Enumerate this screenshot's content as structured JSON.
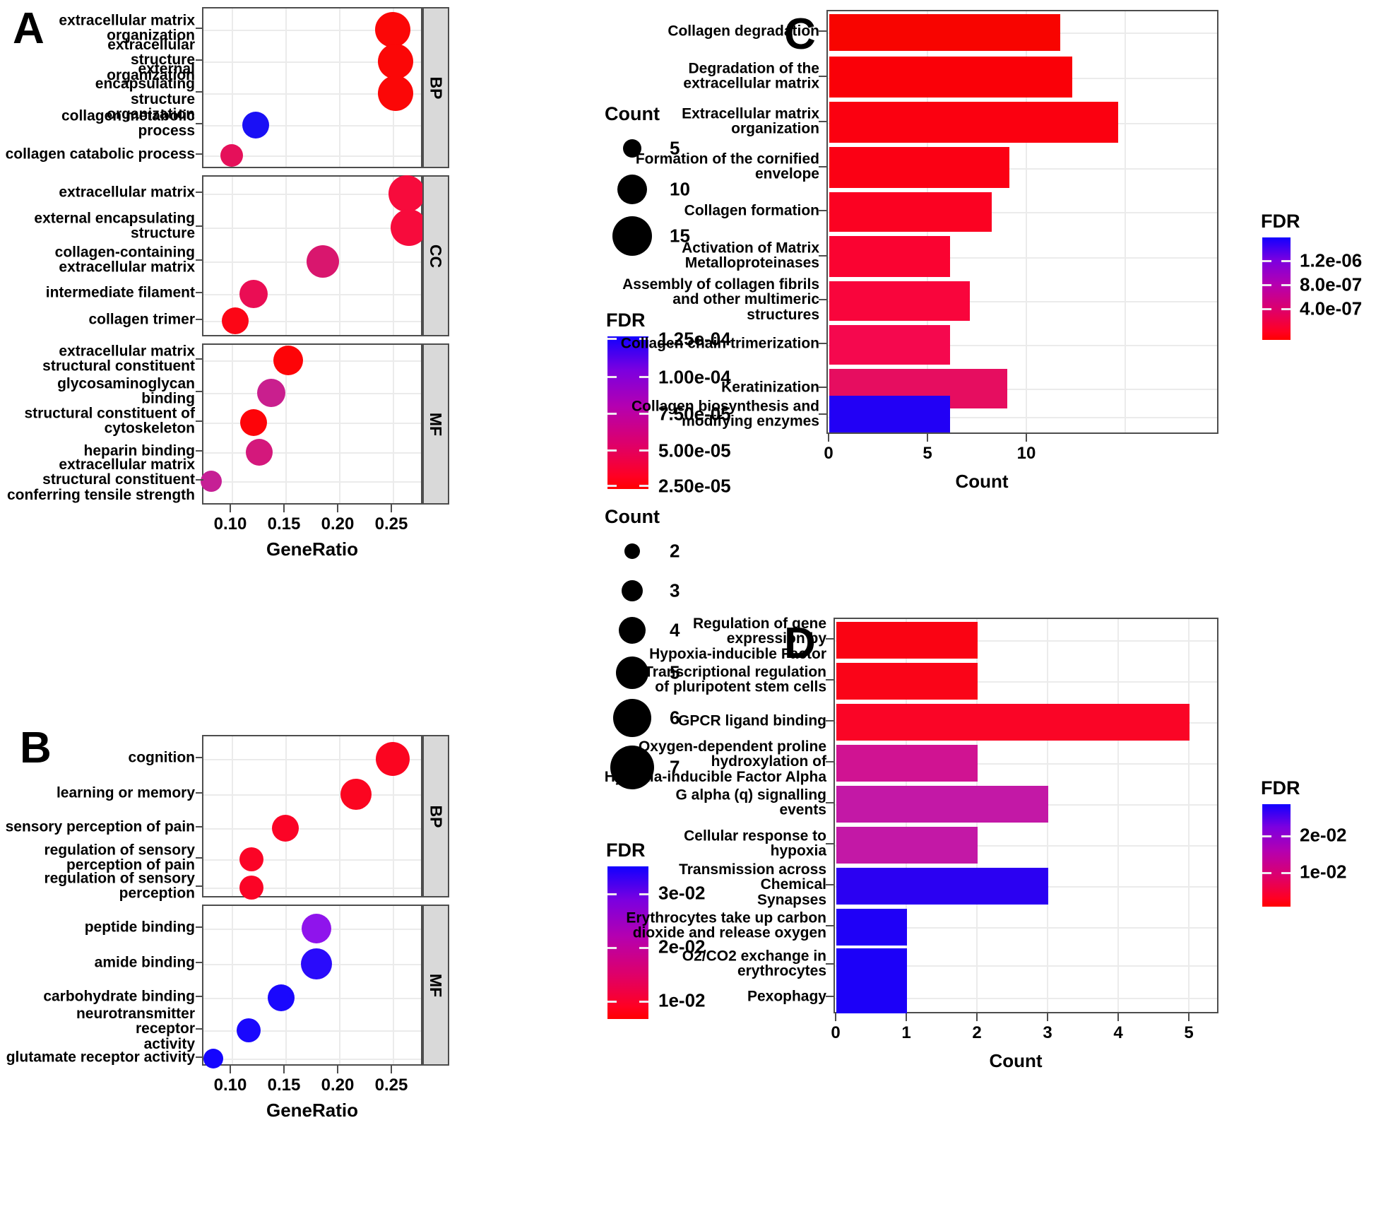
{
  "figure": {
    "panels": [
      "A",
      "B",
      "C",
      "D"
    ]
  },
  "panelA": {
    "letter": "A",
    "xlabel": "GeneRatio",
    "xticks": [
      "0.10",
      "0.15",
      "0.20",
      "0.25"
    ],
    "facets": [
      "BP",
      "CC",
      "MF"
    ],
    "legend": {
      "count_title": "Count",
      "count_values": [
        "5",
        "10",
        "15"
      ],
      "fdr_title": "FDR",
      "fdr_labels": [
        "1.25e-04",
        "1.00e-04",
        "7.50e-05",
        "5.00e-05",
        "2.50e-05"
      ]
    },
    "chart_data": {
      "type": "scatter",
      "title": "",
      "xlabel": "GeneRatio",
      "ylabel": "",
      "xlim": [
        0.06,
        0.265
      ],
      "xticks": [
        0.1,
        0.15,
        0.2,
        0.25
      ],
      "grid": true,
      "size_legend": {
        "name": "Count",
        "values": [
          5,
          10,
          15
        ]
      },
      "color_legend": {
        "name": "FDR",
        "ticks": [
          0.000125,
          0.0001,
          7.5e-05,
          5e-05,
          2.5e-05
        ]
      },
      "facets": [
        {
          "name": "BP",
          "points": [
            {
              "term": "extracellular matrix\norganization",
              "GeneRatio": 0.237,
              "Count": 17,
              "FDR": 2e-05,
              "color": "#fb0707"
            },
            {
              "term": "extracellular structure\norganization",
              "GeneRatio": 0.24,
              "Count": 17,
              "FDR": 2e-05,
              "color": "#fb0707"
            },
            {
              "term": "external encapsulating\nstructure organization",
              "GeneRatio": 0.24,
              "Count": 17,
              "FDR": 2e-05,
              "color": "#fb0707"
            },
            {
              "term": "collagen metabolic process",
              "GeneRatio": 0.112,
              "Count": 8,
              "FDR": 0.000125,
              "color": "#1a10f5"
            },
            {
              "term": "collagen catabolic process",
              "GeneRatio": 0.09,
              "Count": 6,
              "FDR": 3.2e-05,
              "color": "#e5105a"
            }
          ]
        },
        {
          "name": "CC",
          "points": [
            {
              "term": "extracellular matrix",
              "GeneRatio": 0.25,
              "Count": 18,
              "FDR": 2.2e-05,
              "color": "#f70b3c"
            },
            {
              "term": "external encapsulating\nstructure",
              "GeneRatio": 0.252,
              "Count": 18,
              "FDR": 2.2e-05,
              "color": "#f70b3c"
            },
            {
              "term": "collagen-containing\nextracellular matrix",
              "GeneRatio": 0.162,
              "Count": 12,
              "FDR": 4.2e-05,
              "color": "#d9166e"
            },
            {
              "term": "intermediate filament",
              "GeneRatio": 0.11,
              "Count": 8,
              "FDR": 3e-05,
              "color": "#ea0d54"
            },
            {
              "term": "collagen trimer",
              "GeneRatio": 0.093,
              "Count": 7,
              "FDR": 1.8e-05,
              "color": "#fc0616"
            }
          ]
        },
        {
          "name": "MF",
          "points": [
            {
              "term": "extracellular matrix\nstructural constituent",
              "GeneRatio": 0.138,
              "Count": 10,
              "FDR": 1.5e-05,
              "color": "#fd0407"
            },
            {
              "term": "glycosaminoglycan binding",
              "GeneRatio": 0.122,
              "Count": 9,
              "FDR": 5.5e-05,
              "color": "#c91f8e"
            },
            {
              "term": "structural constituent of\ncytoskeleton",
              "GeneRatio": 0.11,
              "Count": 8,
              "FDR": 1.6e-05,
              "color": "#fd0409"
            },
            {
              "term": "heparin binding",
              "GeneRatio": 0.115,
              "Count": 8,
              "FDR": 4.5e-05,
              "color": "#d4187c"
            },
            {
              "term": "extracellular matrix\nstructural constituent\nconferring tensile strength",
              "GeneRatio": 0.07,
              "Count": 5,
              "FDR": 5.8e-05,
              "color": "#c61f95"
            }
          ]
        }
      ]
    }
  },
  "panelB": {
    "letter": "B",
    "xlabel": "GeneRatio",
    "xticks": [
      "0.10",
      "0.15",
      "0.20",
      "0.25"
    ],
    "facets": [
      "BP",
      "MF"
    ],
    "legend": {
      "count_title": "Count",
      "count_values": [
        "2",
        "3",
        "4",
        "5",
        "6",
        "7"
      ],
      "fdr_title": "FDR",
      "fdr_labels": [
        "3e-02",
        "2e-02",
        "1e-02"
      ]
    },
    "chart_data": {
      "type": "scatter",
      "title": "",
      "xlabel": "GeneRatio",
      "ylabel": "",
      "xlim": [
        0.06,
        0.265
      ],
      "xticks": [
        0.1,
        0.15,
        0.2,
        0.25
      ],
      "grid": true,
      "size_legend": {
        "name": "Count",
        "values": [
          2,
          3,
          4,
          5,
          6,
          7
        ]
      },
      "color_legend": {
        "name": "FDR",
        "ticks": [
          0.03,
          0.02,
          0.01
        ]
      },
      "facets": [
        {
          "name": "BP",
          "points": [
            {
              "term": "cognition",
              "GeneRatio": 0.25,
              "Count": 7,
              "FDR": 0.009,
              "color": "#fb0520"
            },
            {
              "term": "learning or memory",
              "GeneRatio": 0.215,
              "Count": 6,
              "FDR": 0.009,
              "color": "#fb0520"
            },
            {
              "term": "sensory perception of pain",
              "GeneRatio": 0.15,
              "Count": 4,
              "FDR": 0.008,
              "color": "#fb0426"
            },
            {
              "term": "regulation of sensory\nperception of pain",
              "GeneRatio": 0.108,
              "Count": 3,
              "FDR": 0.008,
              "color": "#fb0426"
            },
            {
              "term": "regulation of sensory\nperception",
              "GeneRatio": 0.108,
              "Count": 3,
              "FDR": 0.008,
              "color": "#fb0426"
            }
          ]
        },
        {
          "name": "MF",
          "points": [
            {
              "term": "peptide binding",
              "GeneRatio": 0.179,
              "Count": 5,
              "FDR": 0.026,
              "color": "#8f14ec"
            },
            {
              "term": "amide binding",
              "GeneRatio": 0.179,
              "Count": 5,
              "FDR": 0.031,
              "color": "#2a0bfb"
            },
            {
              "term": "carbohydrate binding",
              "GeneRatio": 0.143,
              "Count": 4,
              "FDR": 0.032,
              "color": "#1a08fd"
            },
            {
              "term": "neurotransmitter receptor\nactivity",
              "GeneRatio": 0.108,
              "Count": 3,
              "FDR": 0.032,
              "color": "#1a08fd"
            },
            {
              "term": "glutamate receptor activity",
              "GeneRatio": 0.071,
              "Count": 2,
              "FDR": 0.033,
              "color": "#1405fe"
            }
          ]
        }
      ]
    }
  },
  "panelC": {
    "letter": "C",
    "xlabel": "Count",
    "xticks": [
      "0",
      "5",
      "10"
    ],
    "legend": {
      "fdr_title": "FDR",
      "fdr_labels": [
        "1.2e-06",
        "8.0e-07",
        "4.0e-07"
      ]
    },
    "chart_data": {
      "type": "bar",
      "orientation": "horizontal",
      "title": "",
      "xlabel": "Count",
      "ylabel": "",
      "xlim": [
        0,
        15.5
      ],
      "xticks": [
        0,
        5,
        10
      ],
      "grid": true,
      "categories": [
        "Collagen degradation",
        "Degradation of the\nextracellular matrix",
        "Extracellular matrix\norganization",
        "Formation of the cornified\nenvelope",
        "Collagen formation",
        "Activation of Matrix\nMetalloproteinases",
        "Assembly of collagen fibrils\nand other multimeric\nstructures",
        "Collagen chain trimerization",
        "Keratinization",
        "Collagen biosynthesis and\nmodifying enzymes"
      ],
      "values": [
        11.7,
        12.3,
        14.6,
        9.1,
        8.2,
        6.1,
        7.1,
        6.1,
        9.0,
        6.1
      ],
      "colors": [
        "#f80400",
        "#fa0008",
        "#fb0010",
        "#fb0014",
        "#fb0222",
        "#fa0331",
        "#f9053c",
        "#f5084e",
        "#e60d60",
        "#2200f5"
      ],
      "fdr": [
        3e-07,
        3.2e-07,
        3.4e-07,
        3.6e-07,
        4e-07,
        4.4e-07,
        5e-07,
        5.8e-07,
        7.2e-07,
        1.35e-06
      ]
    }
  },
  "panelD": {
    "letter": "D",
    "xlabel": "Count",
    "xticks": [
      "0",
      "1",
      "2",
      "3",
      "4",
      "5"
    ],
    "legend": {
      "fdr_title": "FDR",
      "fdr_labels": [
        "2e-02",
        "1e-02"
      ]
    },
    "chart_data": {
      "type": "bar",
      "orientation": "horizontal",
      "title": "",
      "xlabel": "Count",
      "ylabel": "",
      "xlim": [
        0,
        5.45
      ],
      "xticks": [
        0,
        1,
        2,
        3,
        4,
        5
      ],
      "grid": true,
      "categories": [
        "Regulation of gene\nexpression by\nHypoxia-inducible Factor",
        "Transcriptional regulation\nof pluripotent stem cells",
        "GPCR ligand binding",
        "Oxygen-dependent proline\nhydroxylation of\nHypoxia-inducible Factor Alpha",
        "G alpha (q) signalling events",
        "Cellular response to hypoxia",
        "Transmission across Chemical\nSynapses",
        "Erythrocytes take up carbon\ndioxide and release oxygen",
        "O2/CO2 exchange in\nerythrocytes",
        "Pexophagy"
      ],
      "values": [
        2,
        2,
        5,
        2,
        3,
        2,
        3,
        1,
        1,
        1
      ],
      "colors": [
        "#fa0313",
        "#fa0418",
        "#fa0526",
        "#d01392",
        "#c318a6",
        "#c318a6",
        "#2b00f2",
        "#1f00f7",
        "#1c00f8",
        "#1c00f8"
      ],
      "fdr": [
        0.0075,
        0.008,
        0.009,
        0.016,
        0.018,
        0.018,
        0.026,
        0.028,
        0.029,
        0.029
      ]
    }
  }
}
